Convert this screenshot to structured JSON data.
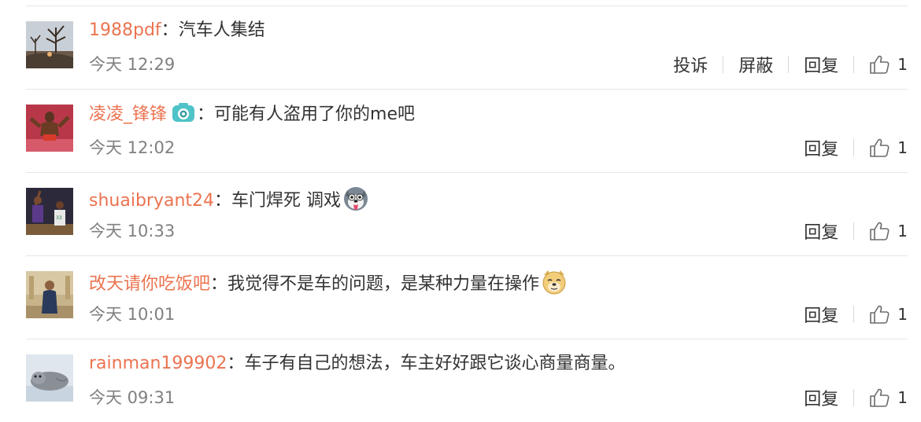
{
  "comments": [
    {
      "user": "1988pdf",
      "colon": "：",
      "text": "汽车人集结",
      "time": "今天 12:29",
      "actions": [
        "投诉",
        "屏蔽",
        "回复"
      ],
      "likes": "1",
      "badge": null,
      "emoji": null
    },
    {
      "user": "凌凌_锋锋",
      "colon": "：",
      "text": "可能有人盗用了你的me吧",
      "time": "今天 12:02",
      "actions": [
        "回复"
      ],
      "likes": "1",
      "badge": "camera-badge-icon",
      "emoji": null
    },
    {
      "user": "shuaibryant24",
      "colon": "：",
      "text": "车门焊死  调戏",
      "time": "今天 10:33",
      "actions": [
        "回复"
      ],
      "likes": "1",
      "badge": null,
      "emoji": "husky-tongue-emoji-icon"
    },
    {
      "user": "改天请你吃饭吧",
      "colon": "：",
      "text": "我觉得不是车的问题，是某种力量在操作",
      "time": "今天 10:01",
      "actions": [
        "回复"
      ],
      "likes": "1",
      "badge": null,
      "emoji": "doge-emoji-icon"
    },
    {
      "user": "rainman199902",
      "colon": "：",
      "text": "车子有自己的想法，车主好好跟它谈心商量商量。",
      "time": "今天 09:31",
      "actions": [
        "回复"
      ],
      "likes": "1",
      "badge": null,
      "emoji": null
    }
  ],
  "colors": {
    "username": "#eb7350",
    "text": "#333333",
    "time": "#808080",
    "divider": "#e6e6e6"
  }
}
